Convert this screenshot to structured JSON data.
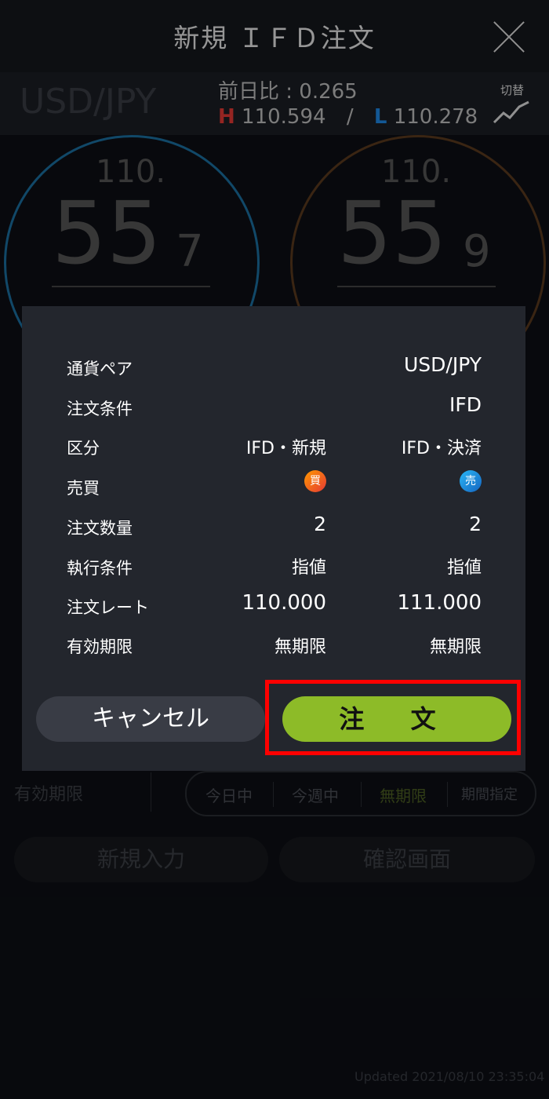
{
  "header": {
    "title": "新規 ＩＦＤ注文"
  },
  "rate_bar": {
    "pair": "USD/JPY",
    "change": "前日比 : 0.265",
    "high_mark": "H",
    "high": "110.594",
    "separator": "/",
    "low_mark": "L",
    "low": "110.278",
    "switch_label": "切替"
  },
  "prices": {
    "bid": {
      "prefix": "110.",
      "main": "55",
      "pip": "7"
    },
    "ask": {
      "prefix": "110.",
      "main": "55",
      "pip": "9"
    }
  },
  "background_form": {
    "expiry_label": "有効期限",
    "expiry_options": [
      "今日中",
      "今週中",
      "無期限",
      "期間指定"
    ],
    "selected_expiry": "無期限",
    "new_input_button": "新規入力",
    "confirm_button": "確認画面"
  },
  "updated": "Updated  2021/08/10 23:35:04",
  "dialog": {
    "rows": [
      {
        "label": "通貨ペア",
        "col1": "",
        "col2": "USD/JPY"
      },
      {
        "label": "注文条件",
        "col1": "",
        "col2": "IFD"
      },
      {
        "label": "区分",
        "col1": "IFD・新規",
        "col2": "IFD・決済"
      },
      {
        "label": "売買",
        "col1": "買",
        "col2": "売"
      },
      {
        "label": "注文数量",
        "col1": "2",
        "col2": "2"
      },
      {
        "label": "執行条件",
        "col1": "指値",
        "col2": "指値"
      },
      {
        "label": "注文レート",
        "col1": "110.000",
        "col2": "111.000"
      },
      {
        "label": "有効期限",
        "col1": "無期限",
        "col2": "無期限"
      }
    ],
    "cancel_label": "キャンセル",
    "order_label": "注 文"
  },
  "colors": {
    "accent_green": "#8dbb28",
    "buy": "#e53935",
    "sell": "#1e88e5",
    "highlight": "#ff0000"
  }
}
